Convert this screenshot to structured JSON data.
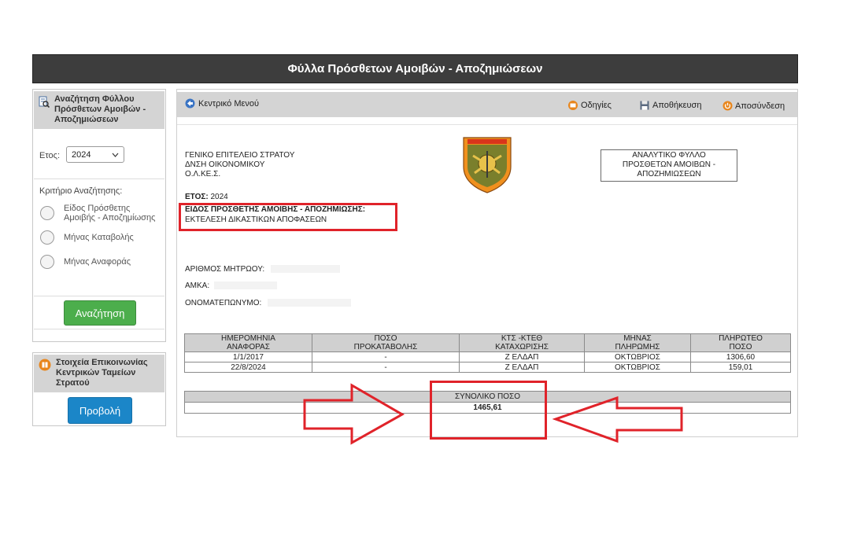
{
  "page_title": "Φύλλα Πρόσθετων Αμοιβών - Αποζημιώσεων",
  "search_panel": {
    "title_line1": "Αναζήτηση Φύλλου",
    "title_line2": "Πρόσθετων Αμοιβών -",
    "title_line3": "Αποζημιώσεων",
    "year_label": "Ετος:",
    "year_value": "2024",
    "criteria_label": "Κριτήριο Αναζήτησης:",
    "option1_line1": "Είδος Πρόσθετης",
    "option1_line2": "Αμοιβής - Αποζημίωσης",
    "option2": "Μήνας Καταβολής",
    "option3": "Μήνας Αναφοράς",
    "search_button": "Αναζήτηση"
  },
  "contact_panel": {
    "title_line1": "Στοιχεία Επικοινωνίας",
    "title_line2": "Κεντρικών Ταμείων",
    "title_line3": "Στρατού",
    "view_button": "Προβολή"
  },
  "toolbar": {
    "main_menu": "Κεντρικό Μενού",
    "instructions": "Οδηγίες",
    "save": "Αποθήκευση",
    "logout": "Αποσύνδεση"
  },
  "document": {
    "org_line1": "ΓΕΝΙΚΟ ΕΠΙΤΕΛΕΙΟ ΣΤΡΑΤΟΥ",
    "org_line2": "ΔΝΣΗ ΟΙΚΟΝΟΜΙΚΟΥ",
    "org_line3": "Ο.Λ.ΚΕ.Σ.",
    "sheet_title_line1": "ΑΝΑΛΥΤΙΚΟ ΦΥΛΛΟ",
    "sheet_title_line2": "ΠΡΟΣΘΕΤΩΝ ΑΜΟΙΒΩΝ -",
    "sheet_title_line3": "ΑΠΟΖΗΜΙΩΣΕΩΝ",
    "year_label": "ΕΤΟΣ:",
    "year_value": " 2024",
    "type_label": "ΕΙΔΟΣ ΠΡΟΣΘΕΤΗΣ ΑΜΟΙΒΗΣ - ΑΠΟΖΗΜΙΩΣΗΣ:",
    "type_value": "ΕΚΤΕΛΕΣΗ ΔΙΚΑΣΤΙΚΩΝ ΑΠΟΦΑΣΕΩΝ",
    "registry_label": "ΑΡΙΘΜΟΣ ΜΗΤΡΩΟΥ:",
    "amka_label": "ΑΜΚΑ:",
    "fullname_label": "ΟΝΟΜΑΤΕΠΩΝΥΜΟ:"
  },
  "payments_table": {
    "headers": [
      [
        "ΗΜΕΡΟΜΗΝΙΑ",
        "ΑΝΑΦΟΡΑΣ"
      ],
      [
        "ΠΟΣΟ",
        "ΠΡΟΚΑΤΑΒΟΛΗΣ"
      ],
      [
        "ΚΤΣ -ΚΤΕΘ",
        "ΚΑΤΑΧΩΡΙΣΗΣ"
      ],
      [
        "ΜΗΝΑΣ",
        "ΠΛΗΡΩΜΗΣ"
      ],
      [
        "ΠΛΗΡΩΤΕΟ",
        "ΠΟΣΟ"
      ]
    ],
    "rows": [
      [
        "1/1/2017",
        "-",
        "Ζ ΕΛΔΑΠ",
        "ΟΚΤΩΒΡΙΟΣ",
        "1306,60"
      ],
      [
        "22/8/2024",
        "-",
        "Ζ ΕΛΔΑΠ",
        "ΟΚΤΩΒΡΙΟΣ",
        "159,01"
      ]
    ]
  },
  "total": {
    "label": "ΣΥΝΟΛΙΚΟ ΠΟΣΟ",
    "value": "1465,61"
  },
  "colors": {
    "annotation_red": "#e0232a",
    "header_dark": "#3d3d3d",
    "search_green": "#4cae4c",
    "view_blue": "#1b86c8"
  }
}
